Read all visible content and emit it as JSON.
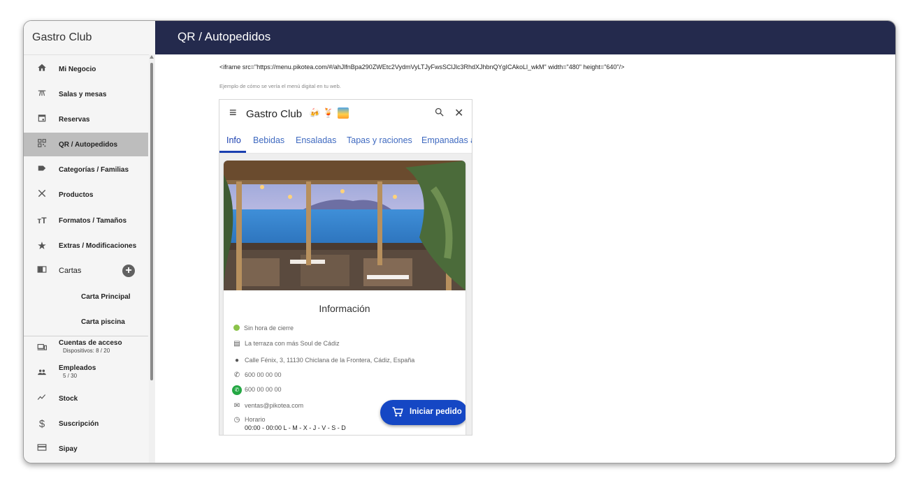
{
  "app": {
    "brand": "Gastro Club",
    "page_title": "QR / Autopedidos"
  },
  "sidebar": {
    "items": [
      {
        "label": "Mi Negocio",
        "icon": "home-icon"
      },
      {
        "label": "Salas y mesas",
        "icon": "table-icon"
      },
      {
        "label": "Reservas",
        "icon": "calendar-icon"
      },
      {
        "label": "QR / Autopedidos",
        "icon": "qr-icon"
      },
      {
        "label": "Categorías / Familias",
        "icon": "label-icon"
      },
      {
        "label": "Productos",
        "icon": "utensils-icon"
      },
      {
        "label": "Formatos / Tamaños",
        "icon": "text-size-icon"
      },
      {
        "label": "Extras / Modificaciones",
        "icon": "star-icon"
      },
      {
        "label": "Cartas",
        "icon": "book-icon"
      },
      {
        "label": "Carta Principal"
      },
      {
        "label": "Carta piscina"
      },
      {
        "label": "Cuentas de acceso",
        "sub": "Dispositivos: 8 / 20",
        "icon": "devices-icon"
      },
      {
        "label": "Empleados",
        "sub": "5 / 30",
        "icon": "people-icon"
      },
      {
        "label": "Stock",
        "icon": "trend-icon"
      },
      {
        "label": "Suscripción",
        "icon": "dollar-icon"
      },
      {
        "label": "Sipay",
        "icon": "card-icon"
      }
    ]
  },
  "main": {
    "embed_code": "<iframe src=\"https://menu.pikotea.com/#/ahJlfnBpa290ZWEtc2VydmVyLTJyFwsSClJlc3RhdXJhbnQYgICAkoLl_wkM\" width=\"480\" height=\"640\"/>",
    "caption": "Ejemplo de cómo se vería el menú digital en tu web."
  },
  "preview": {
    "title": "Gastro Club",
    "title_emoji": "🍻 🍹",
    "tabs": [
      "Info",
      "Bebidas",
      "Ensaladas",
      "Tapas y raciones",
      "Empanadas a"
    ],
    "info_title": "Información",
    "status": "Sin hora de cierre",
    "slogan": "La terraza con más Soul de Cádiz",
    "address": "Calle Fénix, 3, 11130 Chiclana de la Frontera, Cádiz, España",
    "phone": "600 00 00 00",
    "whatsapp": "600 00 00 00",
    "email": "ventas@pikotea.com",
    "schedule_label": "Horario",
    "schedule_value": "00:00 - 00:00   L - M - X - J - V - S - D",
    "order_button": "Iniciar pedido"
  },
  "colors": {
    "header": "#242a4d",
    "accent": "#1547c4",
    "tab": "#3f6ac0",
    "status_green": "#8bc34a",
    "whatsapp": "#25a844"
  }
}
